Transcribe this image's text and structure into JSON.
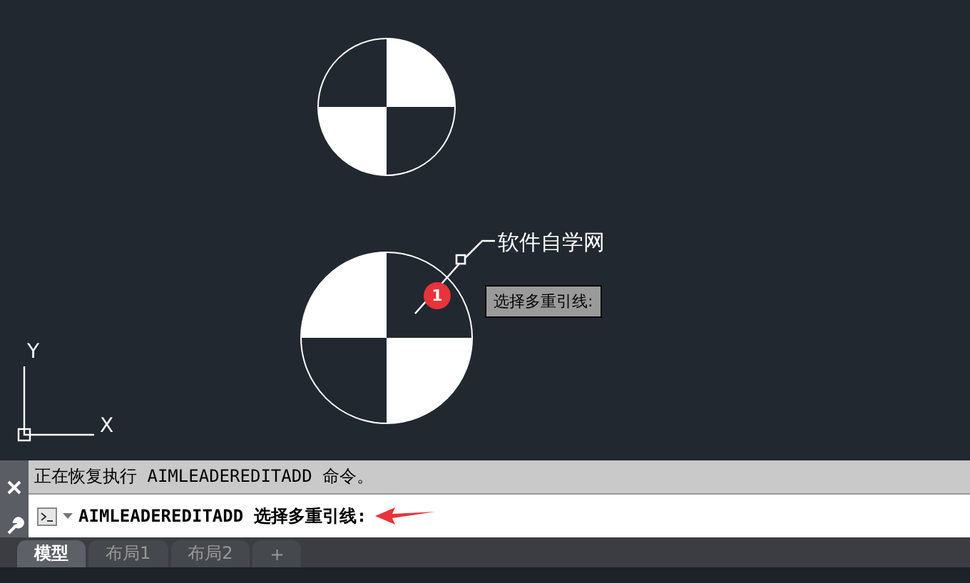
{
  "canvas": {
    "leader_text": "软件自学网",
    "tooltip": "选择多重引线:",
    "badge": "1",
    "ucs": {
      "x_label": "X",
      "y_label": "Y"
    }
  },
  "command_line": {
    "history": "正在恢复执行 AIMLEADEREDITADD 命令。",
    "prompt": "AIMLEADEREDITADD 选择多重引线:"
  },
  "tabs": [
    {
      "label": "模型",
      "selected": true
    },
    {
      "label": "布局1",
      "selected": false
    },
    {
      "label": "布局2",
      "selected": false
    },
    {
      "label": "+",
      "selected": false
    }
  ]
}
